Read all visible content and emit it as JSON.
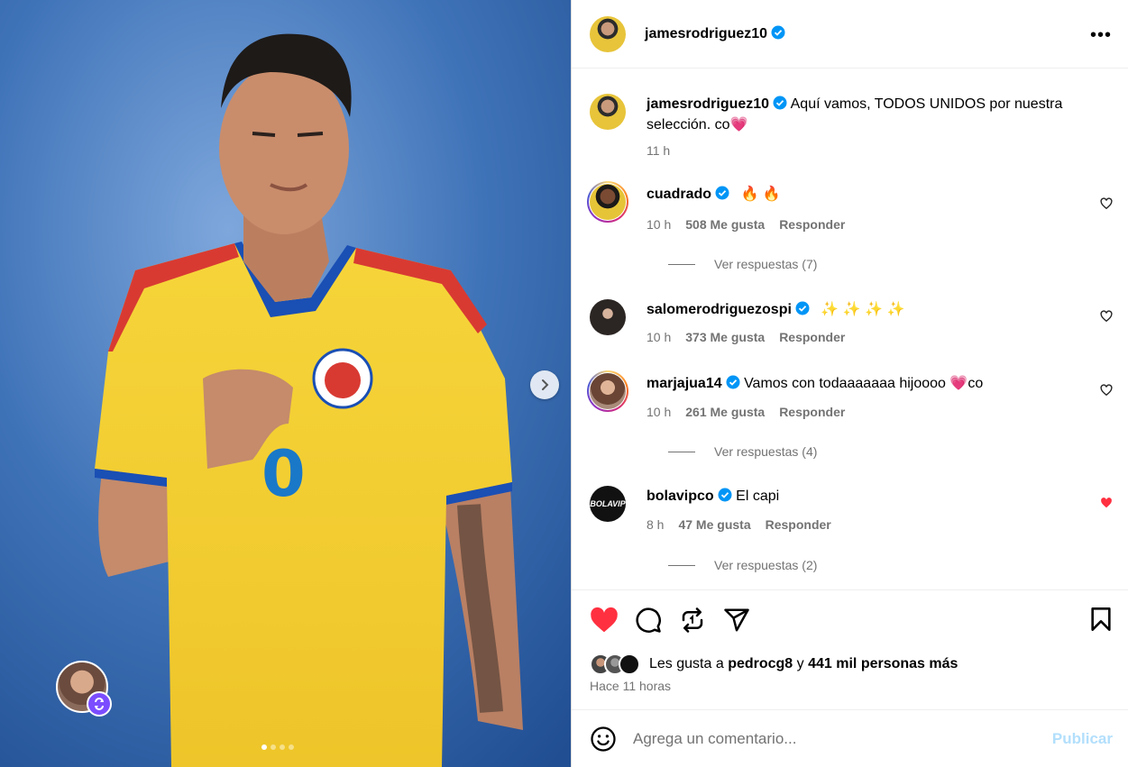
{
  "post": {
    "author": "jamesrodriguez10",
    "more_icon": "more-horizontal-icon",
    "caption_text": "Aquí vamos, TODOS UNIDOS por nuestra selección. co",
    "caption_emoji": "💗",
    "caption_time": "11 h",
    "carousel": {
      "total": 4,
      "active": 1
    }
  },
  "comments": [
    {
      "user": "cuadrado",
      "text": "🔥 🔥",
      "time": "10 h",
      "likes": "508 Me gusta",
      "reply_label": "Responder",
      "replies": "Ver respuestas (7)",
      "liked": false
    },
    {
      "user": "salomerodriguezospi",
      "text": "✨ ✨ ✨ ✨",
      "time": "10 h",
      "likes": "373 Me gusta",
      "reply_label": "Responder",
      "replies": "",
      "liked": false
    },
    {
      "user": "marjajua14",
      "text": "Vamos con todaaaaaaa hijoooo",
      "emoji": "💗",
      "suffix": "co",
      "time": "10 h",
      "likes": "261 Me gusta",
      "reply_label": "Responder",
      "replies": "Ver respuestas (4)",
      "liked": false
    },
    {
      "user": "bolavipco",
      "text": "El capi",
      "time": "8 h",
      "likes": "47 Me gusta",
      "reply_label": "Responder",
      "replies": "Ver respuestas (2)",
      "liked": true
    }
  ],
  "actions": {
    "liked": true,
    "likes_prefix": "Les gusta a",
    "likes_user": "pedrocg8",
    "likes_connector": "y",
    "likes_rest": "441 mil personas más",
    "posted_ago": "Hace 11 horas"
  },
  "composer": {
    "placeholder": "Agrega un comentario...",
    "publish_label": "Publicar"
  },
  "avatars": {
    "bolavip_text": "BOLAVIP"
  },
  "colors": {
    "like_red": "#ff3040",
    "verified_blue": "#0095f6",
    "muted": "#737373",
    "publish_disabled": "#b2dffc"
  }
}
